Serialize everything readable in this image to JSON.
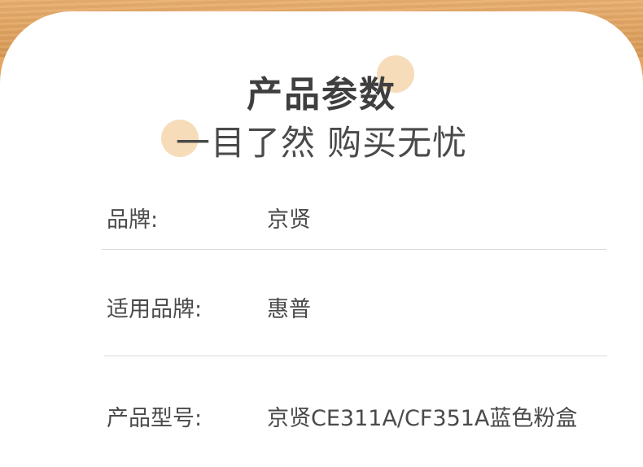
{
  "header": {
    "title": "产品参数",
    "subtitle": "一目了然 购买无忧"
  },
  "params": [
    {
      "label": "品牌:",
      "value": "京贤"
    },
    {
      "label": "适用品牌:",
      "value": "惠普"
    },
    {
      "label": "产品型号:",
      "value": "京贤CE311A/CF351A蓝色粉盒"
    }
  ],
  "colors": {
    "background_wood": "#e2a25d",
    "card": "#ffffff",
    "accent_circle": "#f5d6ad",
    "text": "#4a4a4a"
  }
}
